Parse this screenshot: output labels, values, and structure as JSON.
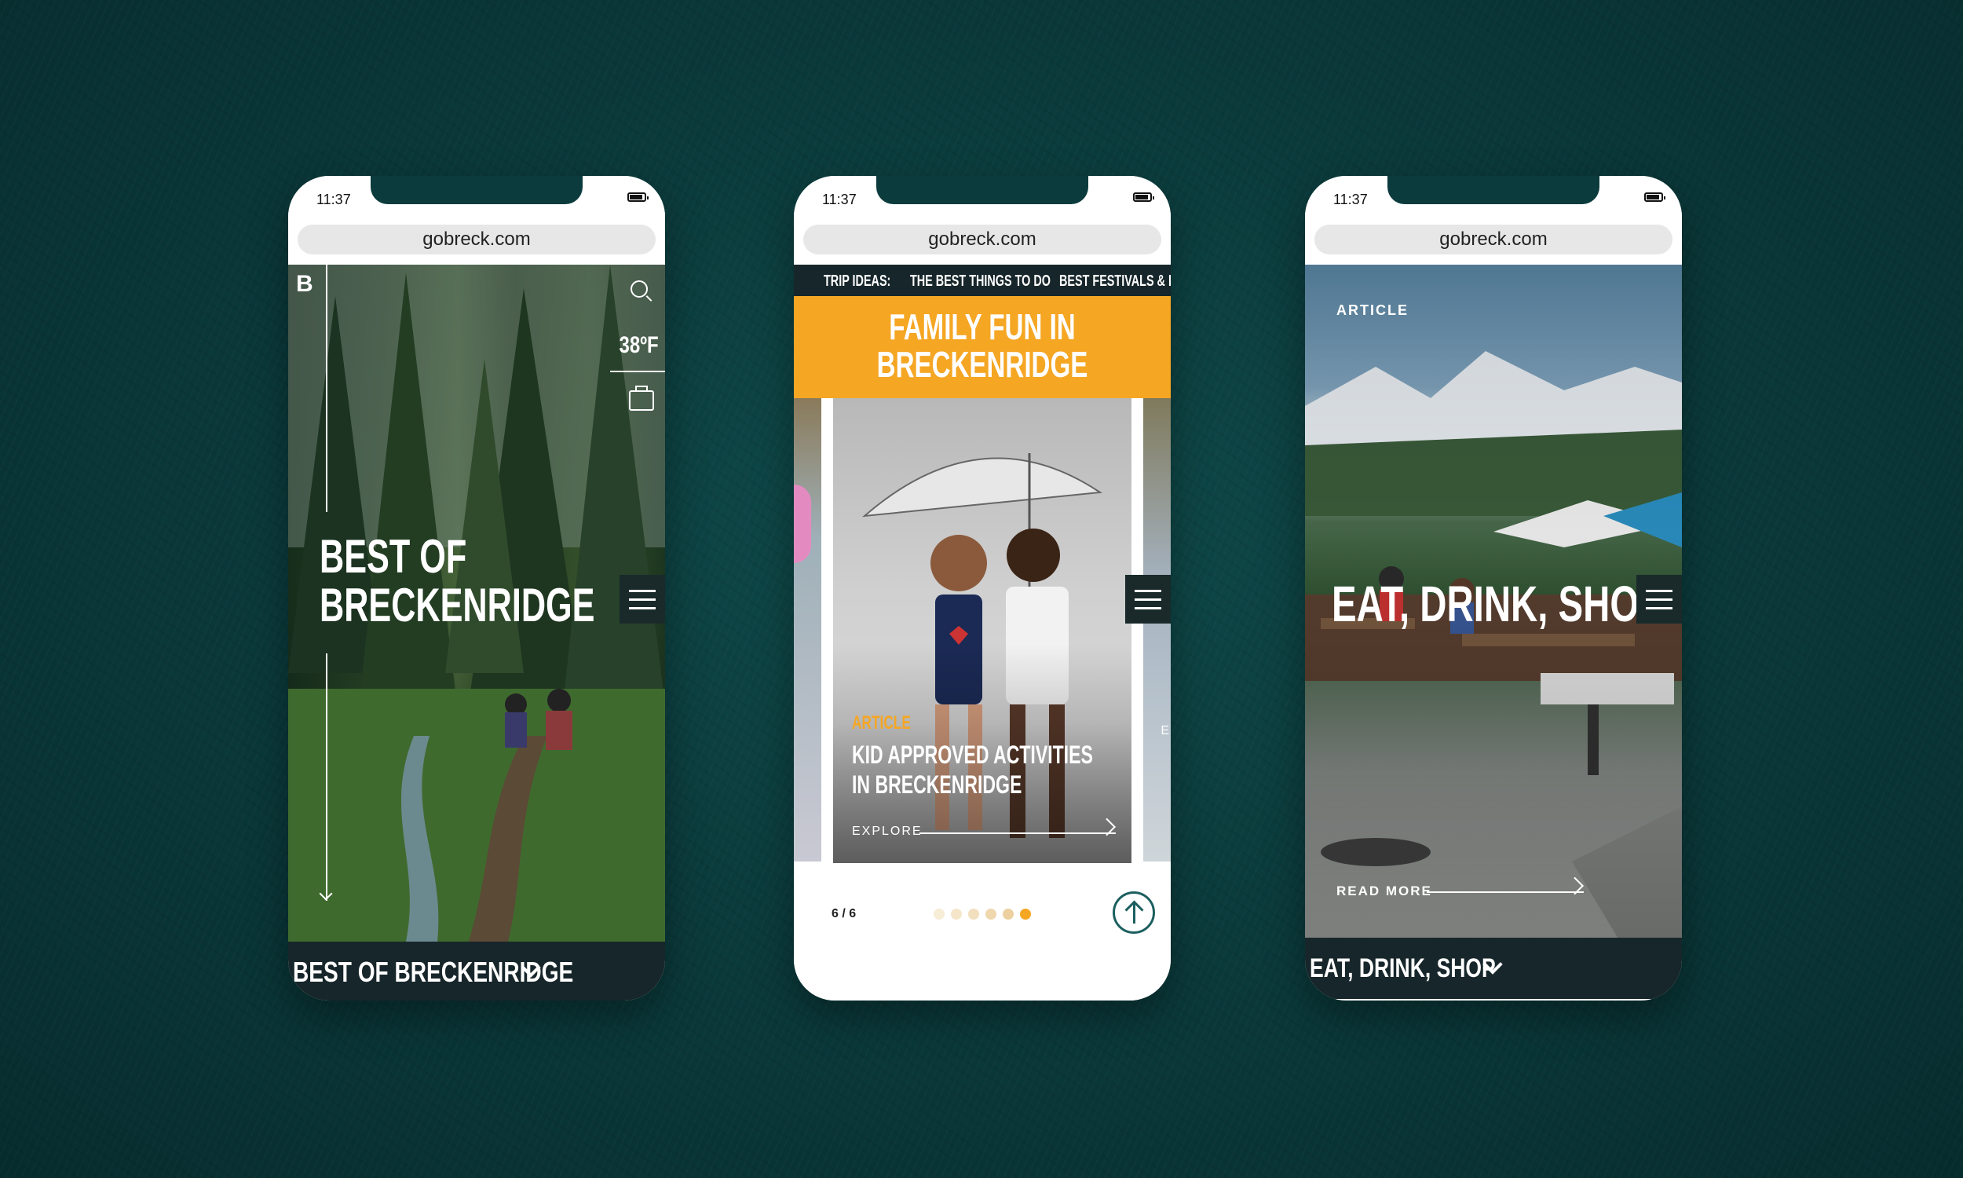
{
  "phones": [
    {
      "time": "11:37",
      "url": "gobreck.com",
      "logo": "B",
      "temperature": "38ºF",
      "hero_title_line1": "BEST OF",
      "hero_title_line2": "BRECKENRIDGE",
      "bottom_label": "BEST OF BRECKENRIDGE"
    },
    {
      "time": "11:37",
      "url": "gobreck.com",
      "trip_ideas_label": "TRIP IDEAS:",
      "trip_links": [
        "THE BEST THINGS TO DO",
        "BEST FESTIVALS & EVE"
      ],
      "banner_line1": "FAMILY FUN IN",
      "banner_line2": "BRECKENRIDGE",
      "card_tag": "ARTICLE",
      "card_title_line1": "KID APPROVED ACTIVITIES",
      "card_title_line2": "IN BRECKENRIDGE",
      "card_cta": "EXPLORE",
      "side_peek_label": "E",
      "pager": "6 / 6",
      "dots_total": 6,
      "dots_active": 6
    },
    {
      "time": "11:37",
      "url": "gobreck.com",
      "tag": "ARTICLE",
      "hero_title": "EAT, DRINK, SHOP",
      "cta": "READ MORE",
      "bottom_label": "EAT, DRINK, SHOP"
    }
  ],
  "colors": {
    "background": "#0b3b3c",
    "accent_yellow": "#f5a623",
    "dark_bar": "#17262a",
    "teal_button": "#1d5f5f"
  },
  "icons": [
    "search-icon",
    "suitcase-icon",
    "menu-icon",
    "chevron-down-icon",
    "arrow-right-icon",
    "arrow-up-icon"
  ]
}
